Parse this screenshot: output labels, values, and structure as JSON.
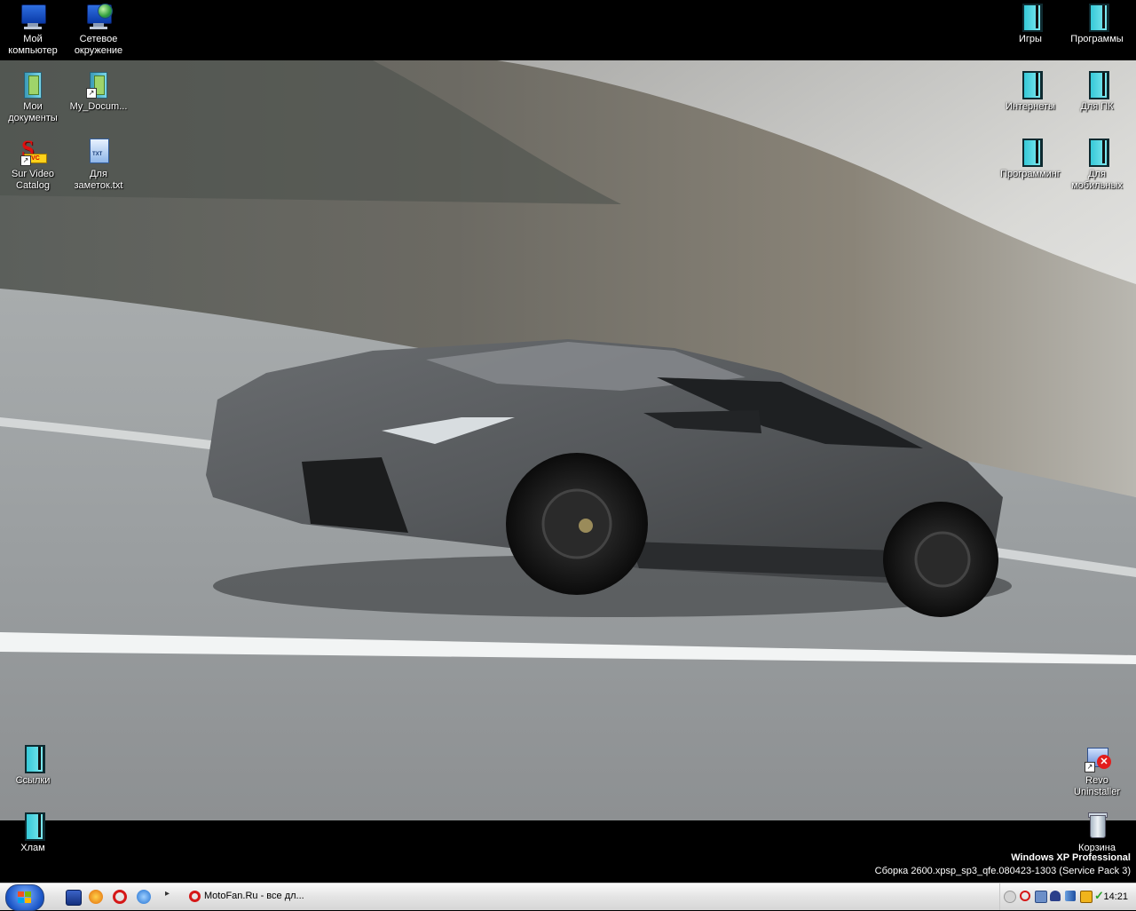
{
  "desktop": {
    "left_icons": [
      {
        "label": "Мой компьютер",
        "icon": "my-computer-icon"
      },
      {
        "label": "Сетевое окружение",
        "icon": "network-icon"
      },
      {
        "label": "Мои документы",
        "icon": "my-documents-icon"
      },
      {
        "label": "My_Docum...",
        "icon": "documents-shortcut-icon"
      },
      {
        "label": "Sur Video Catalog",
        "icon": "sur-video-catalog-icon"
      },
      {
        "label": "Для заметок.txt",
        "icon": "text-file-icon"
      },
      {
        "label": "Ссылки",
        "icon": "folder-icon"
      },
      {
        "label": "Хлам",
        "icon": "folder-icon"
      }
    ],
    "right_icons": [
      {
        "label": "Игры",
        "icon": "folder-icon"
      },
      {
        "label": "Программы",
        "icon": "folder-icon"
      },
      {
        "label": "Интернеты",
        "icon": "folder-icon"
      },
      {
        "label": "Для ПК",
        "icon": "folder-icon"
      },
      {
        "label": "Программинг",
        "icon": "folder-icon"
      },
      {
        "label": "Для мобильных",
        "icon": "folder-icon"
      },
      {
        "label": "Revo Uninstaller",
        "icon": "revo-uninstaller-icon"
      },
      {
        "label": "Корзина",
        "icon": "recycle-bin-icon"
      }
    ]
  },
  "watermark": {
    "line1": "Windows XP Professional",
    "line2": "Сборка 2600.xpsp_sp3_qfe.080423-1303 (Service Pack 3)"
  },
  "taskbar": {
    "task_label": "MotoFan.Ru - все дл...",
    "clock": "14:21",
    "quicklaunch_chevron": "▸"
  },
  "colors": {
    "accent_folder": "#36c9d8",
    "taskbar_bg": "#e4e4e4"
  }
}
